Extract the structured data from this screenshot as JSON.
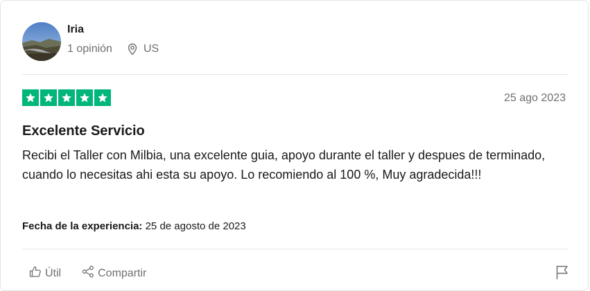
{
  "reviewer": {
    "name": "Iria",
    "reviews_count": "1 opinión",
    "country": "US"
  },
  "review": {
    "rating": 5,
    "star_color": "#00b67a",
    "date": "25 ago 2023",
    "title": "Excelente Servicio",
    "body": "Recibi el Taller con Milbia, una excelente guia, apoyo durante el taller y despues de terminado, cuando lo necesitas ahi esta su apoyo. Lo recomiendo al 100 %, Muy agradecida!!!",
    "experience_label": "Fecha de la experiencia:",
    "experience_date": "25 de agosto de 2023"
  },
  "actions": {
    "useful_label": "Útil",
    "share_label": "Compartir"
  },
  "icons": {
    "location": "location-pin-icon",
    "useful": "thumbs-up-icon",
    "share": "share-icon",
    "report": "flag-icon"
  }
}
